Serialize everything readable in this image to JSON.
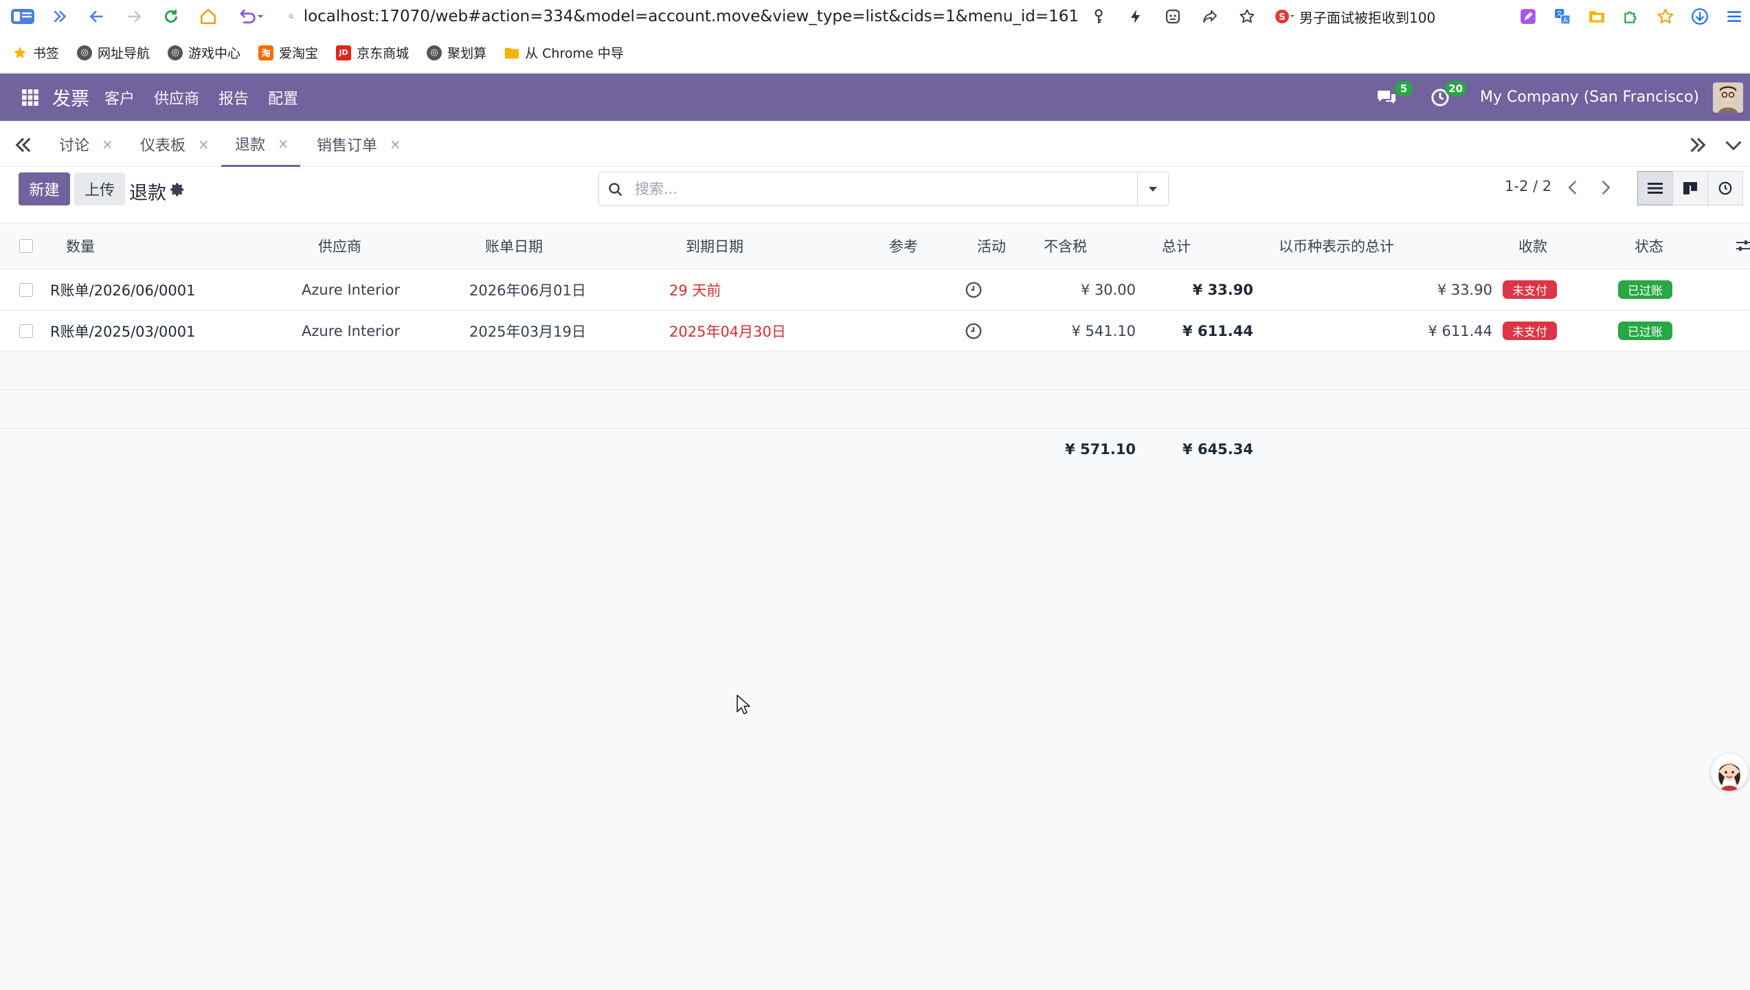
{
  "browser": {
    "url": "localhost:17070/web#action=334&model=account.move&view_type=list&cids=1&menu_id=161",
    "news_text": "男子面试被拒收到100",
    "bookmarks": [
      "书签",
      "网址导航",
      "游戏中心",
      "爱淘宝",
      "京东商城",
      "聚划算",
      "从 Chrome 中导"
    ]
  },
  "navbar": {
    "brand": "发票",
    "menu": [
      "客户",
      "供应商",
      "报告",
      "配置"
    ],
    "messages_count": "5",
    "activities_count": "20",
    "company": "My Company (San Francisco)"
  },
  "tabs": [
    {
      "label": "讨论",
      "close": "×"
    },
    {
      "label": "仪表板",
      "close": "×"
    },
    {
      "label": "退款",
      "close": "×",
      "active": true
    },
    {
      "label": "销售订单",
      "close": "×"
    }
  ],
  "control_panel": {
    "new_label": "新建",
    "upload_label": "上传",
    "title": "退款",
    "search_placeholder": "搜索...",
    "pager": "1-2 / 2"
  },
  "table": {
    "columns": [
      "数量",
      "供应商",
      "账单日期",
      "到期日期",
      "参考",
      "活动",
      "不含税",
      "总计",
      "以币种表示的总计",
      "收款",
      "状态"
    ],
    "rows": [
      {
        "number": "R账单/2026/06/0001",
        "vendor": "Azure Interior",
        "bill_date": "2026年06月01日",
        "due_date": "29 天前",
        "reference": "",
        "untaxed": "¥ 30.00",
        "total": "¥ 33.90",
        "total_currency": "¥ 33.90",
        "payment": "未支付",
        "status": "已过账"
      },
      {
        "number": "R账单/2025/03/0001",
        "vendor": "Azure Interior",
        "bill_date": "2025年03月19日",
        "due_date": "2025年04月30日",
        "reference": "",
        "untaxed": "¥ 541.10",
        "total": "¥ 611.44",
        "total_currency": "¥ 611.44",
        "payment": "未支付",
        "status": "已过账"
      }
    ],
    "sum_untaxed": "¥ 571.10",
    "sum_total": "¥ 645.34"
  },
  "colors": {
    "brand": "#71639e",
    "danger": "#dc3545",
    "success": "#28a745"
  }
}
